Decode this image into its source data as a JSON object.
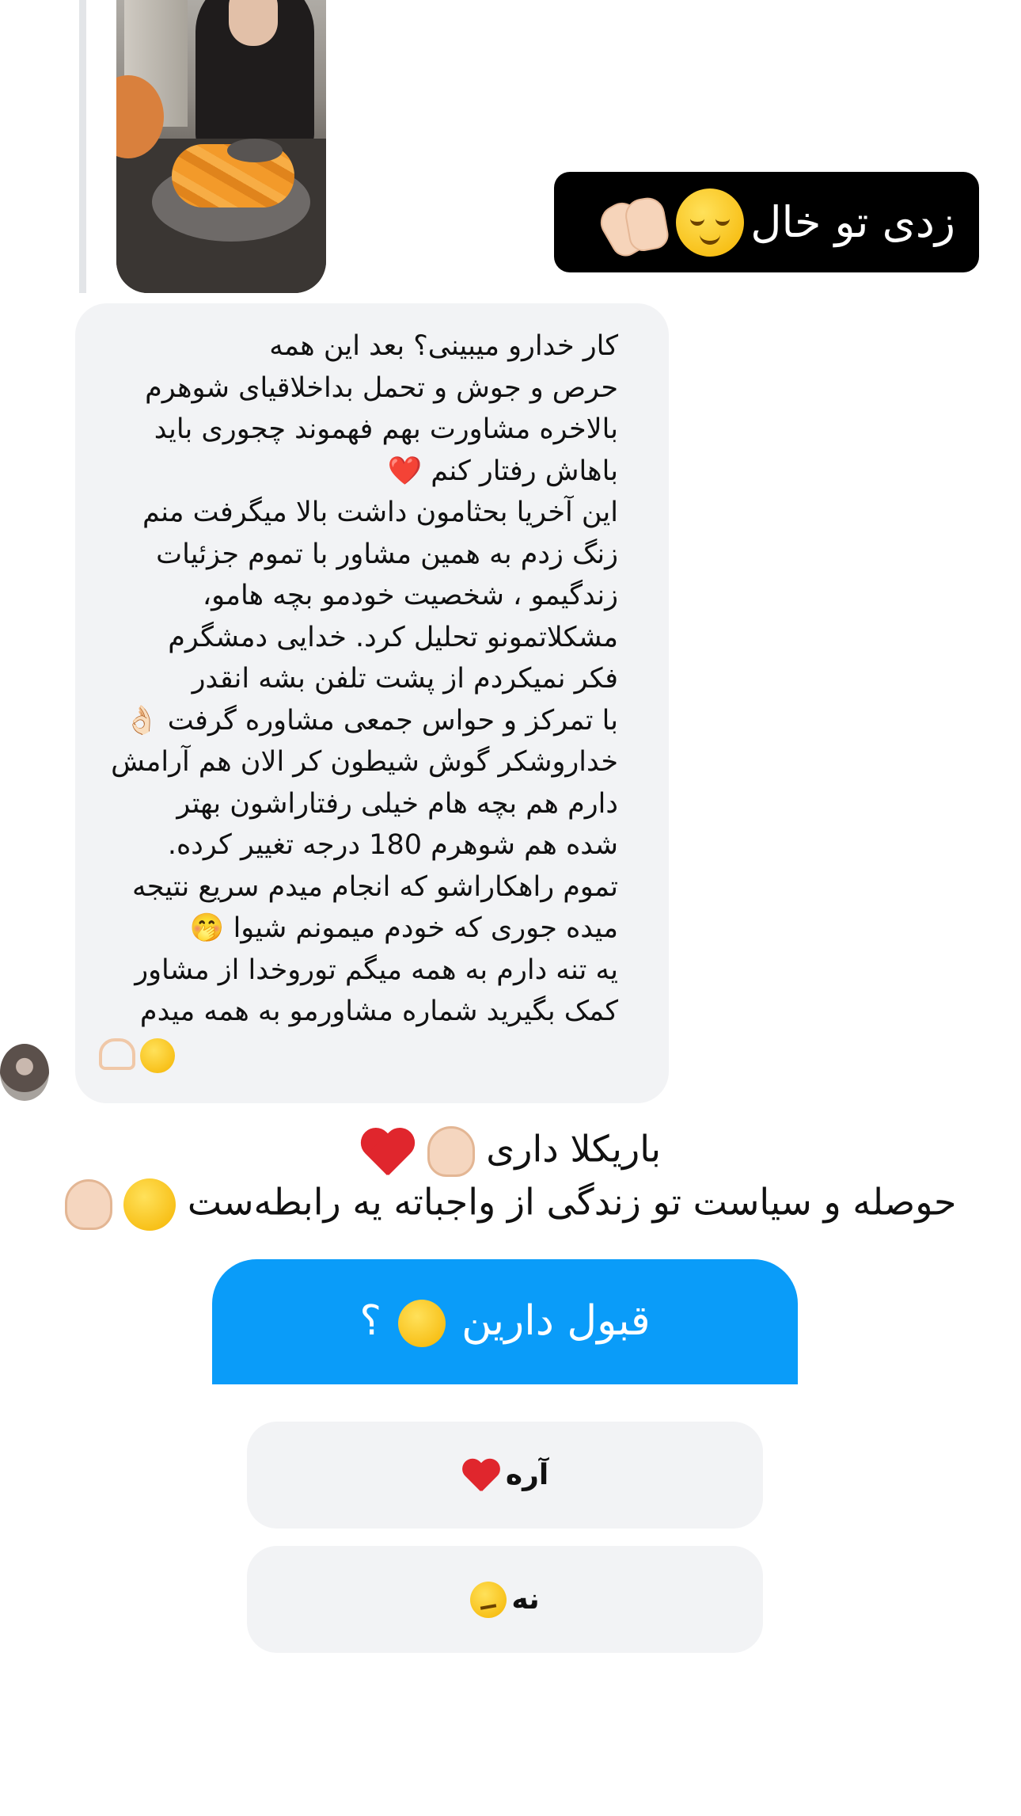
{
  "sticker": {
    "text": "زدی تو خال",
    "emojis": [
      "relieved-face",
      "clapping-hands"
    ]
  },
  "message": {
    "body": "کار خدارو میبینی؟ بعد این همه\nحرص و جوش و تحمل بداخلاقیای شوهرم\nبالاخره مشاورت بهم فهموند چجوری باید\nباهاش رفتار کنم ❤️\nاین آخریا بحثامون داشت بالا میگرفت منم\nزنگ زدم به همین مشاور با تموم جزئیات\nزندگیمو ، شخصیت خودمو بچه هامو،\nمشکلاتمونو تحلیل کرد. خدایی دمشگرم\nفکر نمیکردم از پشت تلفن بشه انقدر\nبا تمرکز و حواس جمعی مشاوره گرفت 👌🏻\nخداروشکر گوش شیطون کر الان هم آرامش\nدارم هم بچه هام خیلی رفتاراشون بهتر\nشده هم شوهرم 180 درجه تغییر کرده.\nتموم راهکاراشو که انجام میدم سریع نتیجه\nمیده جوری که خودم میمونم شیوا 🤭\nیه تنه دارم به همه میگم توروخدا از مشاور\nکمک بگیرید شماره مشاورمو به همه میدم",
    "trailing_emojis": [
      "face-with-tears-of-joy",
      "heart-hands"
    ]
  },
  "captions": {
    "line1": "باریکلا داری",
    "line2": "حوصله و سیاست تو زندگی از واجباته یه رابطه‌ست"
  },
  "poll": {
    "question": "قبول دارین",
    "question_suffix": "؟",
    "header_color": "#0a9cf9",
    "options": [
      {
        "label": "آره",
        "emoji": "red-heart"
      },
      {
        "label": "نه",
        "emoji": "confused-face"
      }
    ]
  }
}
